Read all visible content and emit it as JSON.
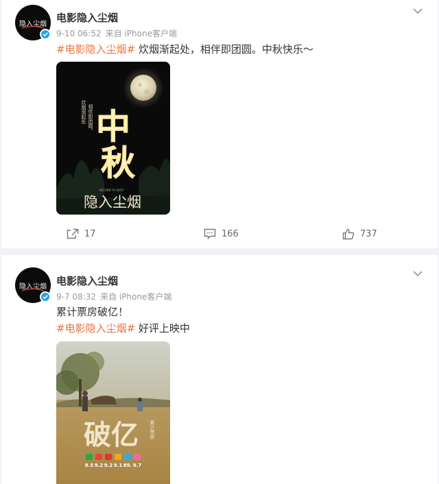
{
  "posts": [
    {
      "username": "电影隐入尘烟",
      "avatar_text": "隐入尘烟",
      "time": "9-10 06:52",
      "source": "来自 iPhone客户端",
      "hashtag": "#电影隐入尘烟#",
      "text_after_tag": " 炊烟渐起处，相伴即团圆。中秋快乐～",
      "poster": {
        "big_chars": [
          "中",
          "秋"
        ],
        "vertical_text": [
          "炊烟渐起处",
          "相伴即团圆。"
        ],
        "title_calligraphy": "隐入尘烟",
        "subtitle": "RETURN TO DUST"
      },
      "actions": {
        "repost_count": "17",
        "comment_count": "166",
        "like_count": "737"
      },
      "icons": [
        "chevron-down-icon",
        "repost-icon",
        "comment-icon",
        "like-icon",
        "verified-icon"
      ]
    },
    {
      "username": "电影隐入尘烟",
      "avatar_text": "隐入尘烟",
      "time": "9-7 08:32",
      "source": "来自 iPhone客户端",
      "line1": "累计票房破亿！",
      "hashtag": "#电影隐入尘烟#",
      "text_after_tag": " 好评上映中",
      "poster": {
        "big_text": "破亿",
        "vertical_text": "累计票房",
        "ratings": [
          "8.5",
          "9.2",
          "9.2",
          "9.1",
          "89.",
          "9.7"
        ]
      },
      "icons": [
        "chevron-down-icon",
        "verified-icon"
      ]
    }
  ],
  "colors": {
    "accent": "#eb7340",
    "verified": "#1da1f2",
    "page_bg": "#f1f2f5"
  }
}
